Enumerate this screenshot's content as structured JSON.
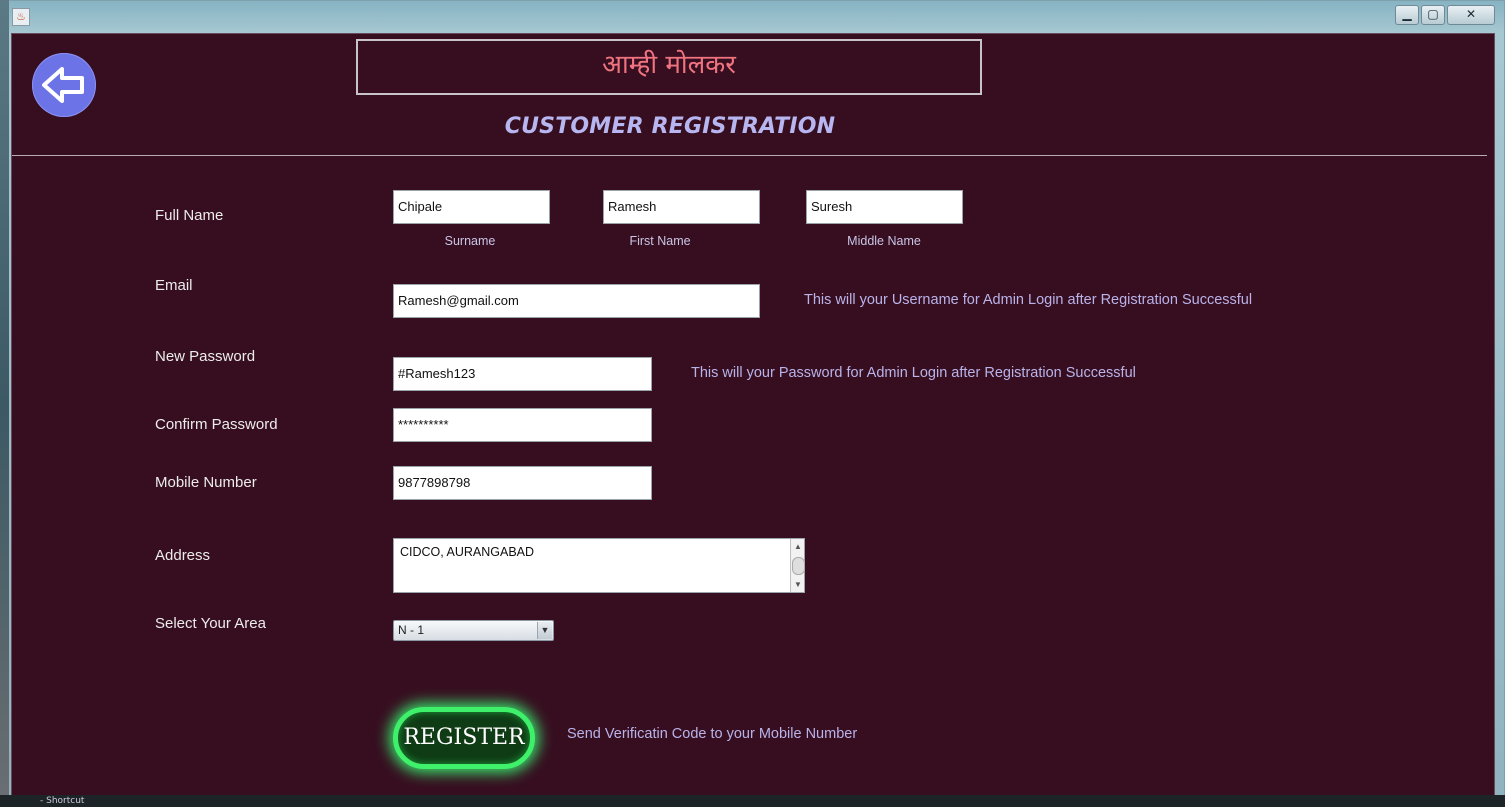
{
  "window": {
    "controls": {
      "minimize": "▁",
      "maximize": "▢",
      "close": "✕"
    }
  },
  "header": {
    "brand_title": "आम्ही मोलकर",
    "heading": "CUSTOMER REGISTRATION",
    "back_icon": "arrow-left-icon"
  },
  "form": {
    "full_name": {
      "label": "Full Name",
      "surname": {
        "value": "Chipale",
        "caption": "Surname"
      },
      "first_name": {
        "value": "Ramesh",
        "caption": "First Name"
      },
      "middle_name": {
        "value": "Suresh",
        "caption": "Middle Name"
      }
    },
    "email": {
      "label": "Email",
      "value": "Ramesh@gmail.com",
      "hint": "This will your Username for Admin Login after Registration Successful"
    },
    "new_password": {
      "label": "New Password",
      "value": "#Ramesh123",
      "hint": "This will your Password for Admin Login after Registration Successful"
    },
    "confirm_password": {
      "label": "Confirm Password",
      "value": "**********"
    },
    "mobile": {
      "label": "Mobile Number",
      "value": "9877898798"
    },
    "address": {
      "label": "Address",
      "value": "CIDCO, AURANGABAD"
    },
    "area": {
      "label": "Select Your Area",
      "selected": "N - 1"
    },
    "register": {
      "label": "REGISTER",
      "hint": "Send Verificatin Code to your Mobile Number"
    }
  },
  "desktop": {
    "shortcut_text": "- Shortcut"
  },
  "colors": {
    "background": "#370e20",
    "accent": "#b7b6f0",
    "title": "#f07480",
    "register_glow": "#3ff06a",
    "back_button": "#6b73e6"
  }
}
